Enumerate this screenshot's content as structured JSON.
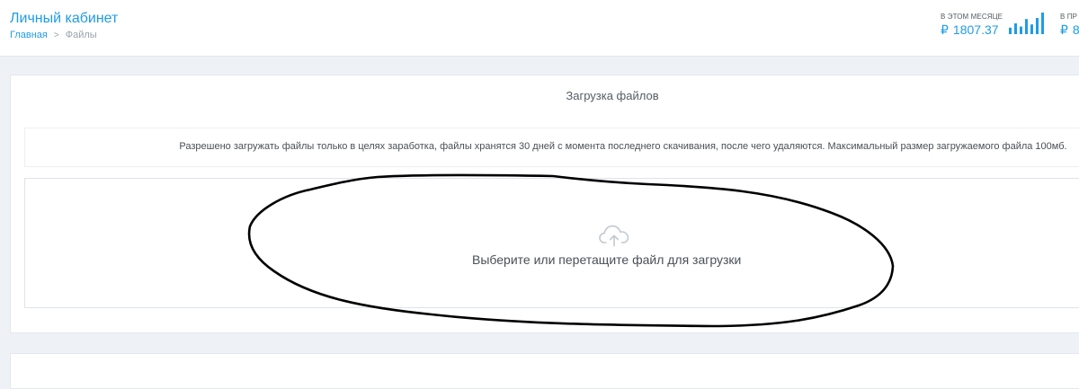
{
  "header": {
    "title": "Личный кабинет",
    "breadcrumb": {
      "home": "Главная",
      "separator": ">",
      "current": "Файлы"
    }
  },
  "stats": {
    "this_month": {
      "label": "В ЭТОМ МЕСЯЦЕ",
      "currency": "₽",
      "value": "1807.37"
    },
    "other": {
      "label": "В ПР",
      "currency": "₽",
      "value": "8"
    },
    "bar_levels": [
      0.3,
      0.5,
      0.35,
      0.7,
      0.45,
      0.75,
      1.0
    ],
    "accent_color": "#1e9ce6"
  },
  "upload": {
    "title": "Загрузка файлов",
    "notice": "Разрешено загружать файлы только в целях заработка, файлы хранятся 30 дней с момента последнего скачивания, после чего удаляются. Максимальный размер загружаемого файла 100мб.",
    "dropzone_icon": "cloud-upload-icon",
    "dropzone_text": "Выберите или перетащите файл для загрузки"
  }
}
